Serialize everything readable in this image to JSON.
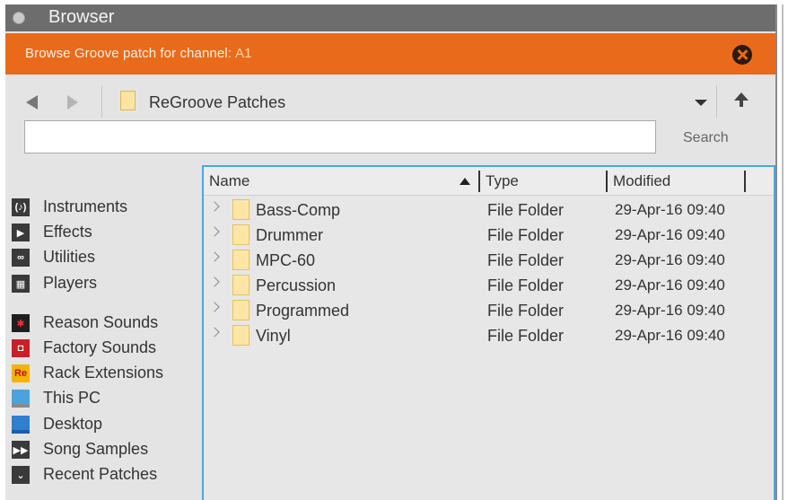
{
  "window": {
    "title": "Browser"
  },
  "banner": {
    "text": "Browse Groove patch for channel:",
    "channel": "A1"
  },
  "nav": {
    "path": "ReGroove Patches"
  },
  "search": {
    "value": "",
    "label": "Search"
  },
  "sidebar": {
    "items": [
      {
        "label": "Instruments",
        "icon": "instruments-icon",
        "color": "#3a3a3a"
      },
      {
        "label": "Effects",
        "icon": "effects-icon",
        "color": "#3a3a3a"
      },
      {
        "label": "Utilities",
        "icon": "utilities-icon",
        "color": "#3a3a3a"
      },
      {
        "label": "Players",
        "icon": "players-icon",
        "color": "#3a3a3a"
      },
      {
        "label": "Reason Sounds",
        "icon": "reason-sounds-icon",
        "color": "#1f1f1f"
      },
      {
        "label": "Factory Sounds",
        "icon": "factory-sounds-icon",
        "color": "#c8202a"
      },
      {
        "label": "Rack Extensions",
        "icon": "rack-extensions-icon",
        "color": "#f4b400"
      },
      {
        "label": "This PC",
        "icon": "this-pc-icon",
        "color": "#4aa3df"
      },
      {
        "label": "Desktop",
        "icon": "desktop-icon",
        "color": "#2e7fd0"
      },
      {
        "label": "Song Samples",
        "icon": "song-samples-icon",
        "color": "#3a3a3a"
      },
      {
        "label": "Recent Patches",
        "icon": "recent-patches-icon",
        "color": "#3a3a3a"
      }
    ]
  },
  "table": {
    "columns": {
      "name": "Name",
      "type": "Type",
      "modified": "Modified"
    },
    "rows": [
      {
        "name": "Bass-Comp",
        "type": "File Folder",
        "modified": "29-Apr-16 09:40"
      },
      {
        "name": "Drummer",
        "type": "File Folder",
        "modified": "29-Apr-16 09:40"
      },
      {
        "name": "MPC-60",
        "type": "File Folder",
        "modified": "29-Apr-16 09:40"
      },
      {
        "name": "Percussion",
        "type": "File Folder",
        "modified": "29-Apr-16 09:40"
      },
      {
        "name": "Programmed",
        "type": "File Folder",
        "modified": "29-Apr-16 09:40"
      },
      {
        "name": "Vinyl",
        "type": "File Folder",
        "modified": "29-Apr-16 09:40"
      }
    ]
  },
  "colors": {
    "banner": "#e96a1a",
    "titlebar": "#6d6d6d",
    "selection_border": "#4ba6e0"
  }
}
